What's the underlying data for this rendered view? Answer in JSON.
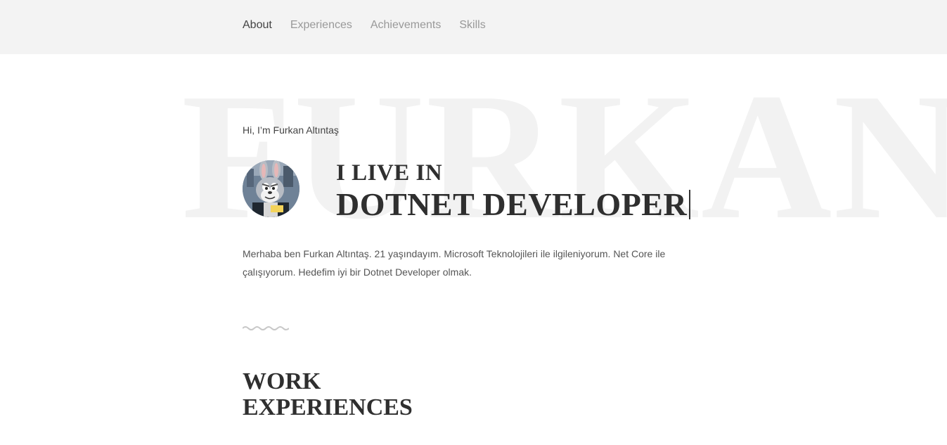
{
  "nav": {
    "items": [
      {
        "label": "About",
        "active": true
      },
      {
        "label": "Experiences",
        "active": false
      },
      {
        "label": "Achievements",
        "active": false
      },
      {
        "label": "Skills",
        "active": false
      }
    ]
  },
  "hero": {
    "watermark": "FURKAN",
    "greeting": "Hi, I’m Furkan Altıntaş",
    "avatar_icon": "cartoon-rabbit-avatar",
    "headline_line1": "I LIVE IN",
    "headline_line2": "DOTNET DEVELOPER",
    "bio": "Merhaba ben Furkan Altıntaş. 21 yaşındayım. Microsoft Teknolojileri ile ilgileniyorum. Net Core ile çalışıyorum. Hedefim iyi bir Dotnet Developer olmak."
  },
  "divider": {
    "icon": "wavy-divider-icon",
    "color": "#c8c8c8"
  },
  "experiences": {
    "title_line1": "WORK",
    "title_line2": "EXPERIENCES"
  },
  "colors": {
    "navbar_bg": "#f3f3f3",
    "nav_active": "#444444",
    "nav_inactive": "#999999",
    "heading": "#2f2f2f",
    "watermark": "#f2f2f2"
  }
}
